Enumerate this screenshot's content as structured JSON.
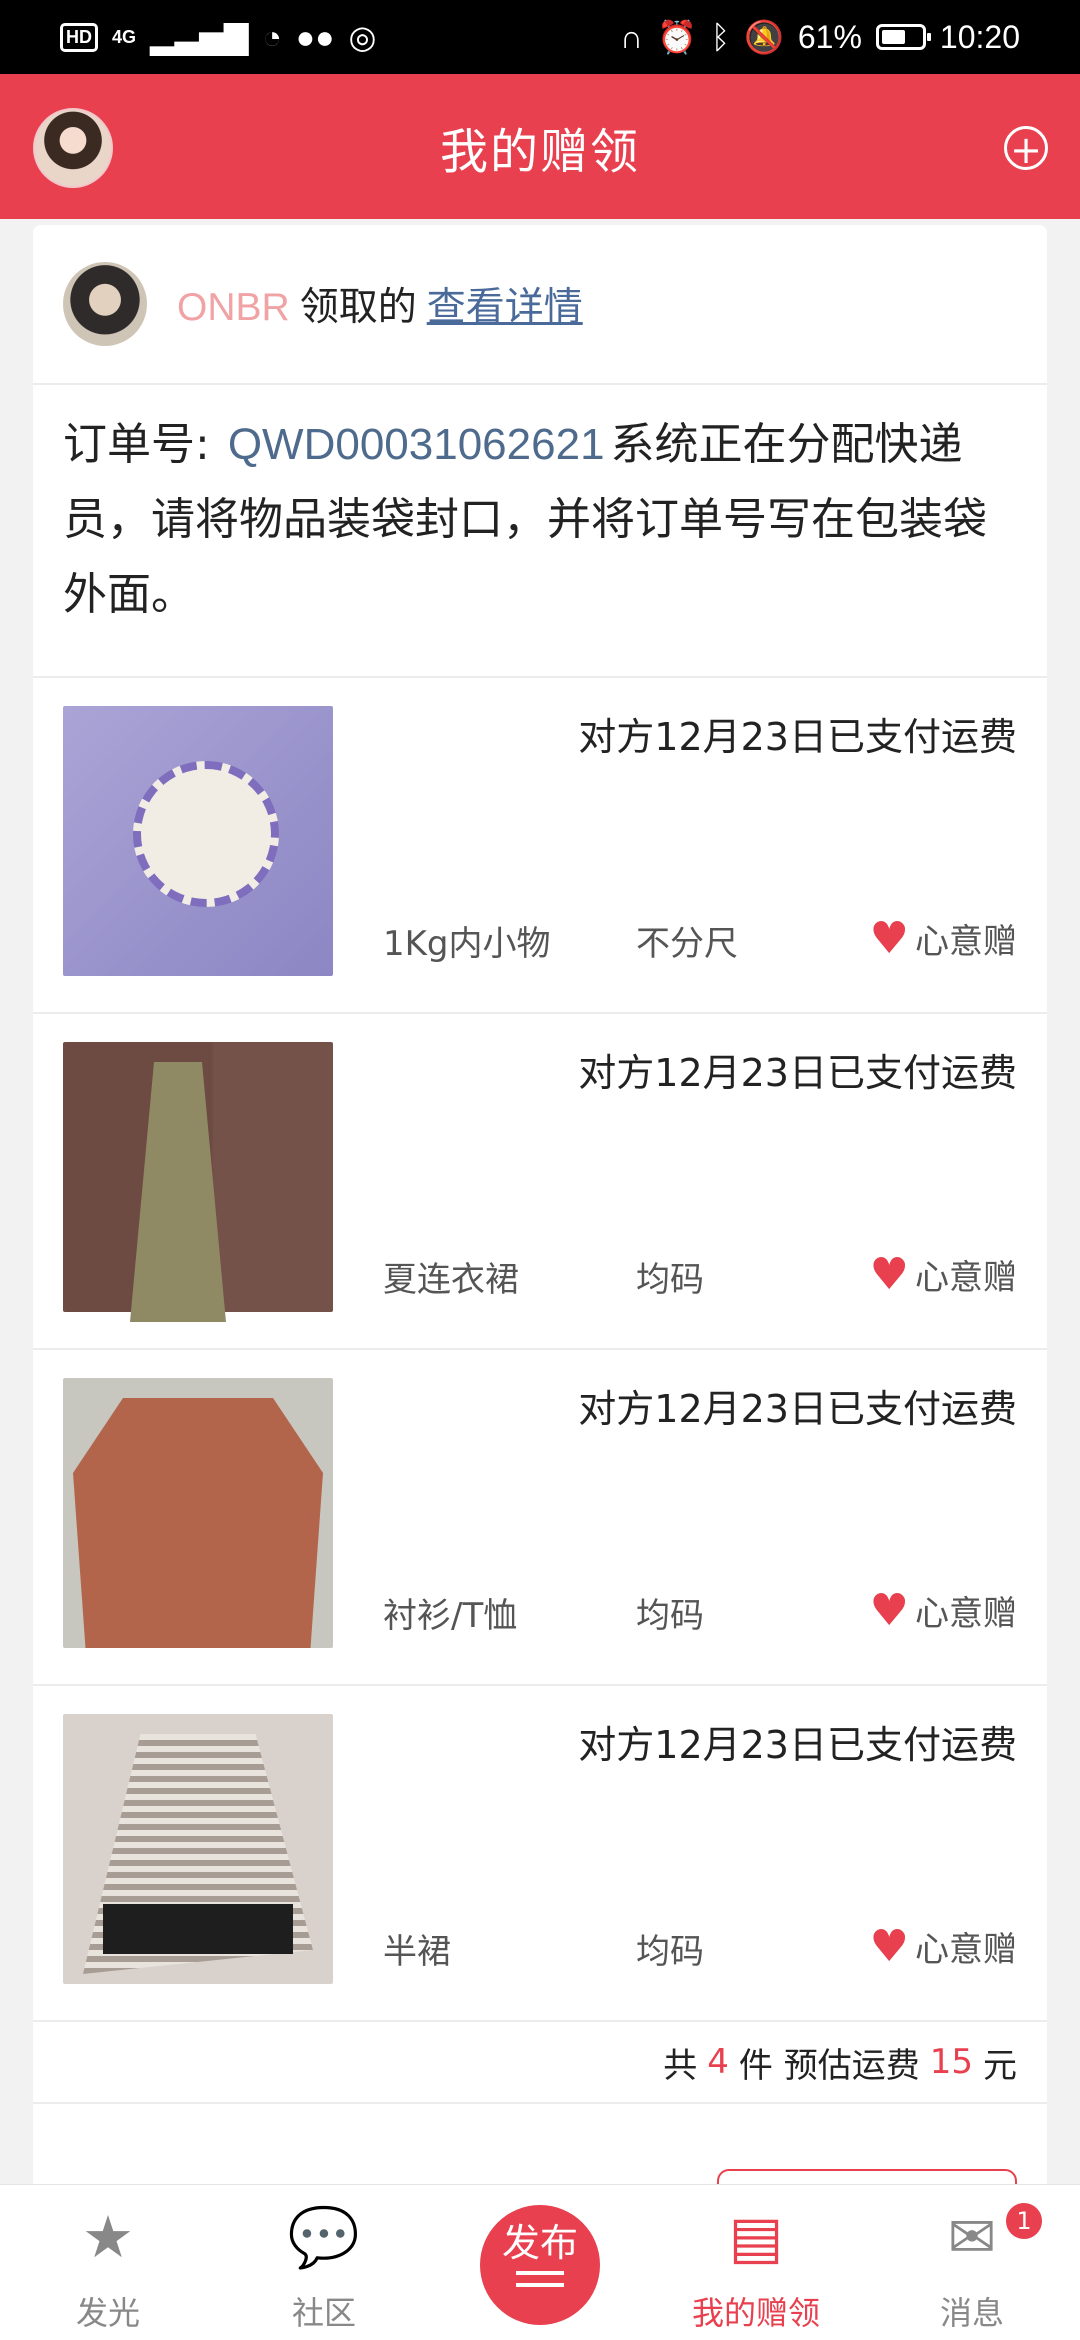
{
  "status_bar": {
    "hd": "HD",
    "network": "4G",
    "battery_text": "61%",
    "battery_level": 0.61,
    "time": "10:20"
  },
  "header": {
    "title": "我的赠领"
  },
  "claim": {
    "user_name": "ONBR",
    "action_text": "领取的",
    "detail_link": "查看详情"
  },
  "order": {
    "label": "订单号:",
    "number": "QWD00031062621",
    "message": "系统正在分配快递员，请将物品装袋封口，并将订单号写在包装袋外面。"
  },
  "items": [
    {
      "shipping": "对方12月23日已支付运费",
      "category": "1Kg内小物",
      "size": "不分尺",
      "gift_type": "心意赠"
    },
    {
      "shipping": "对方12月23日已支付运费",
      "category": "夏连衣裙",
      "size": "均码",
      "gift_type": "心意赠"
    },
    {
      "shipping": "对方12月23日已支付运费",
      "category": "衬衫/T恤",
      "size": "均码",
      "gift_type": "心意赠"
    },
    {
      "shipping": "对方12月23日已支付运费",
      "category": "半裙",
      "size": "均码",
      "gift_type": "心意赠"
    }
  ],
  "summary": {
    "prefix": "共",
    "count": "4",
    "count_unit": "件 预估运费",
    "fee": "15",
    "fee_unit": "元"
  },
  "nav": {
    "items": [
      {
        "label": "发光",
        "icon": "star-icon"
      },
      {
        "label": "社区",
        "icon": "chat-bubble-icon"
      },
      {
        "label": "发布",
        "icon": "publish-icon"
      },
      {
        "label": "我的赠领",
        "icon": "gift-box-icon"
      },
      {
        "label": "消息",
        "icon": "mail-icon",
        "badge": "1"
      }
    ]
  },
  "colors": {
    "accent": "#e8404f",
    "link": "#4a6a9a",
    "username": "#f0a2a5"
  }
}
